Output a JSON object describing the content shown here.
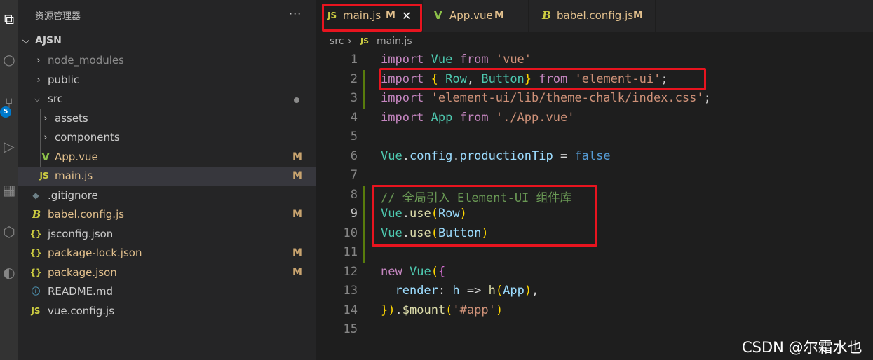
{
  "activity_bar": {
    "items": [
      {
        "name": "explorer-icon",
        "glyph": "⧉"
      },
      {
        "name": "search-icon",
        "glyph": "○"
      },
      {
        "name": "source-control-icon",
        "glyph": "⑂"
      },
      {
        "name": "run-debug-icon",
        "glyph": "▷"
      },
      {
        "name": "extensions-icon",
        "glyph": "▦"
      },
      {
        "name": "remote-icon",
        "glyph": "⬡"
      },
      {
        "name": "account-icon",
        "glyph": "◐"
      }
    ],
    "source_control_badge": "5"
  },
  "sidebar": {
    "title": "资源管理器",
    "more": "···",
    "project": "AJSN",
    "tree": [
      {
        "label": "node_modules",
        "type": "folder",
        "depth": 1,
        "state": "collapsed",
        "dimmed": true
      },
      {
        "label": "public",
        "type": "folder",
        "depth": 1,
        "state": "collapsed"
      },
      {
        "label": "src",
        "type": "folder",
        "depth": 1,
        "state": "expanded",
        "dot": true
      },
      {
        "label": "assets",
        "type": "folder",
        "depth": 2,
        "state": "collapsed"
      },
      {
        "label": "components",
        "type": "folder",
        "depth": 2,
        "state": "collapsed"
      },
      {
        "label": "App.vue",
        "type": "vue",
        "depth": 2,
        "badge": "M",
        "modified": true
      },
      {
        "label": "main.js",
        "type": "js",
        "depth": 2,
        "badge": "M",
        "modified": true,
        "selected": true
      },
      {
        "label": ".gitignore",
        "type": "git",
        "depth": 1
      },
      {
        "label": "babel.config.js",
        "type": "babel",
        "depth": 1,
        "badge": "M",
        "modified": true
      },
      {
        "label": "jsconfig.json",
        "type": "json",
        "depth": 1
      },
      {
        "label": "package-lock.json",
        "type": "json",
        "depth": 1,
        "badge": "M",
        "modified": true
      },
      {
        "label": "package.json",
        "type": "json",
        "depth": 1,
        "badge": "M",
        "modified": true
      },
      {
        "label": "README.md",
        "type": "info",
        "depth": 1
      },
      {
        "label": "vue.config.js",
        "type": "js",
        "depth": 1
      }
    ]
  },
  "tabs": [
    {
      "label": "main.js",
      "icon": "JS",
      "badge": "M",
      "close": "✕",
      "active": true
    },
    {
      "label": "App.vue",
      "icon": "V",
      "badge": "M"
    },
    {
      "label": "babel.config.js",
      "icon": "B",
      "badge": "M"
    }
  ],
  "breadcrumb": {
    "folder": "src",
    "sep": "›",
    "icon": "JS",
    "file": "main.js"
  },
  "editor": {
    "line_numbers": [
      "1",
      "2",
      "3",
      "4",
      "5",
      "6",
      "7",
      "8",
      "9",
      "10",
      "11",
      "12",
      "13",
      "14",
      "15"
    ],
    "current_line": 9,
    "code_lines": [
      "import Vue from 'vue'",
      "import { Row, Button} from 'element-ui';",
      "import 'element-ui/lib/theme-chalk/index.css';",
      "import App from './App.vue'",
      "",
      "Vue.config.productionTip = false",
      "",
      "// 全局引入 Element-UI 组件库",
      "Vue.use(Row)",
      "Vue.use(Button)",
      "",
      "new Vue({",
      "  render: h => h(App),",
      "}).$mount('#app')",
      ""
    ]
  },
  "colors": {
    "highlight_box": "#e8141f",
    "git_added_bar": "#587c0c",
    "modified_text": "#e2c08d",
    "js_icon": "#cbcb41",
    "vue_icon": "#8dc149",
    "accent_badge": "#007acc"
  },
  "watermark": "CSDN @尔霜水也"
}
